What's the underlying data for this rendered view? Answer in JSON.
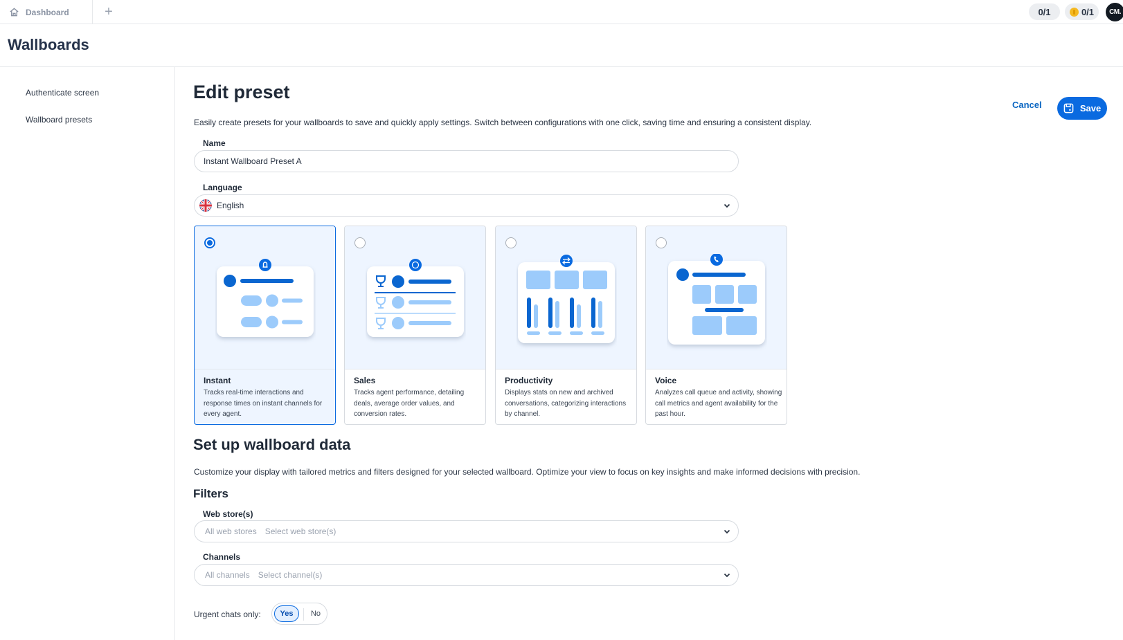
{
  "topbar": {
    "tab_label": "Dashboard",
    "add_tab_symbol": "+",
    "counter_1": "0/1",
    "counter_2": "0/1",
    "avatar_text": "CM."
  },
  "page": {
    "title": "Wallboards"
  },
  "sidebar": {
    "items": [
      {
        "label": "Authenticate screen"
      },
      {
        "label": "Wallboard presets"
      }
    ]
  },
  "main": {
    "title": "Edit preset",
    "description": "Easily create presets for your wallboards to save and quickly apply settings. Switch between configurations with one click, saving time and ensuring a consistent display.",
    "cancel_label": "Cancel",
    "save_label": "Save",
    "name": {
      "label": "Name",
      "value": "Instant Wallboard Preset A"
    },
    "language": {
      "label": "Language",
      "value": "English",
      "flag": "uk-flag-icon"
    },
    "presets": [
      {
        "title": "Instant",
        "description": "Tracks real-time interactions and response times on instant channels for every agent.",
        "selected": true,
        "badge_icon": "bell-icon"
      },
      {
        "title": "Sales",
        "description": "Tracks agent performance, detailing deals, average order values, and conversion rates.",
        "selected": false,
        "badge_icon": "dollar-icon"
      },
      {
        "title": "Productivity",
        "description": "Displays stats on new and archived conversations, categorizing interactions by channel.",
        "selected": false,
        "badge_icon": "swap-arrows-icon"
      },
      {
        "title": "Voice",
        "description": "Analyzes call queue and activity, showing call metrics and agent availability for the past hour.",
        "selected": false,
        "badge_icon": "phone-icon"
      }
    ],
    "setup": {
      "title": "Set up wallboard data",
      "description": "Customize your display with tailored metrics and filters designed for your selected wallboard. Optimize your view to focus on key insights and make informed decisions with precision.",
      "filters_title": "Filters",
      "web_stores": {
        "label": "Web store(s)",
        "value": "All web stores",
        "placeholder": "Select web store(s)"
      },
      "channels": {
        "label": "Channels",
        "value": "All channels",
        "placeholder": "Select channel(s)"
      },
      "urgent": {
        "label": "Urgent chats only:",
        "yes": "Yes",
        "no": "No",
        "selected": "Yes"
      }
    }
  },
  "colors": {
    "accent": "#0a6ae0",
    "card_bg": "#eef5ff",
    "illus_dark": "#0a66d0",
    "illus_light": "#9ccbfb"
  }
}
